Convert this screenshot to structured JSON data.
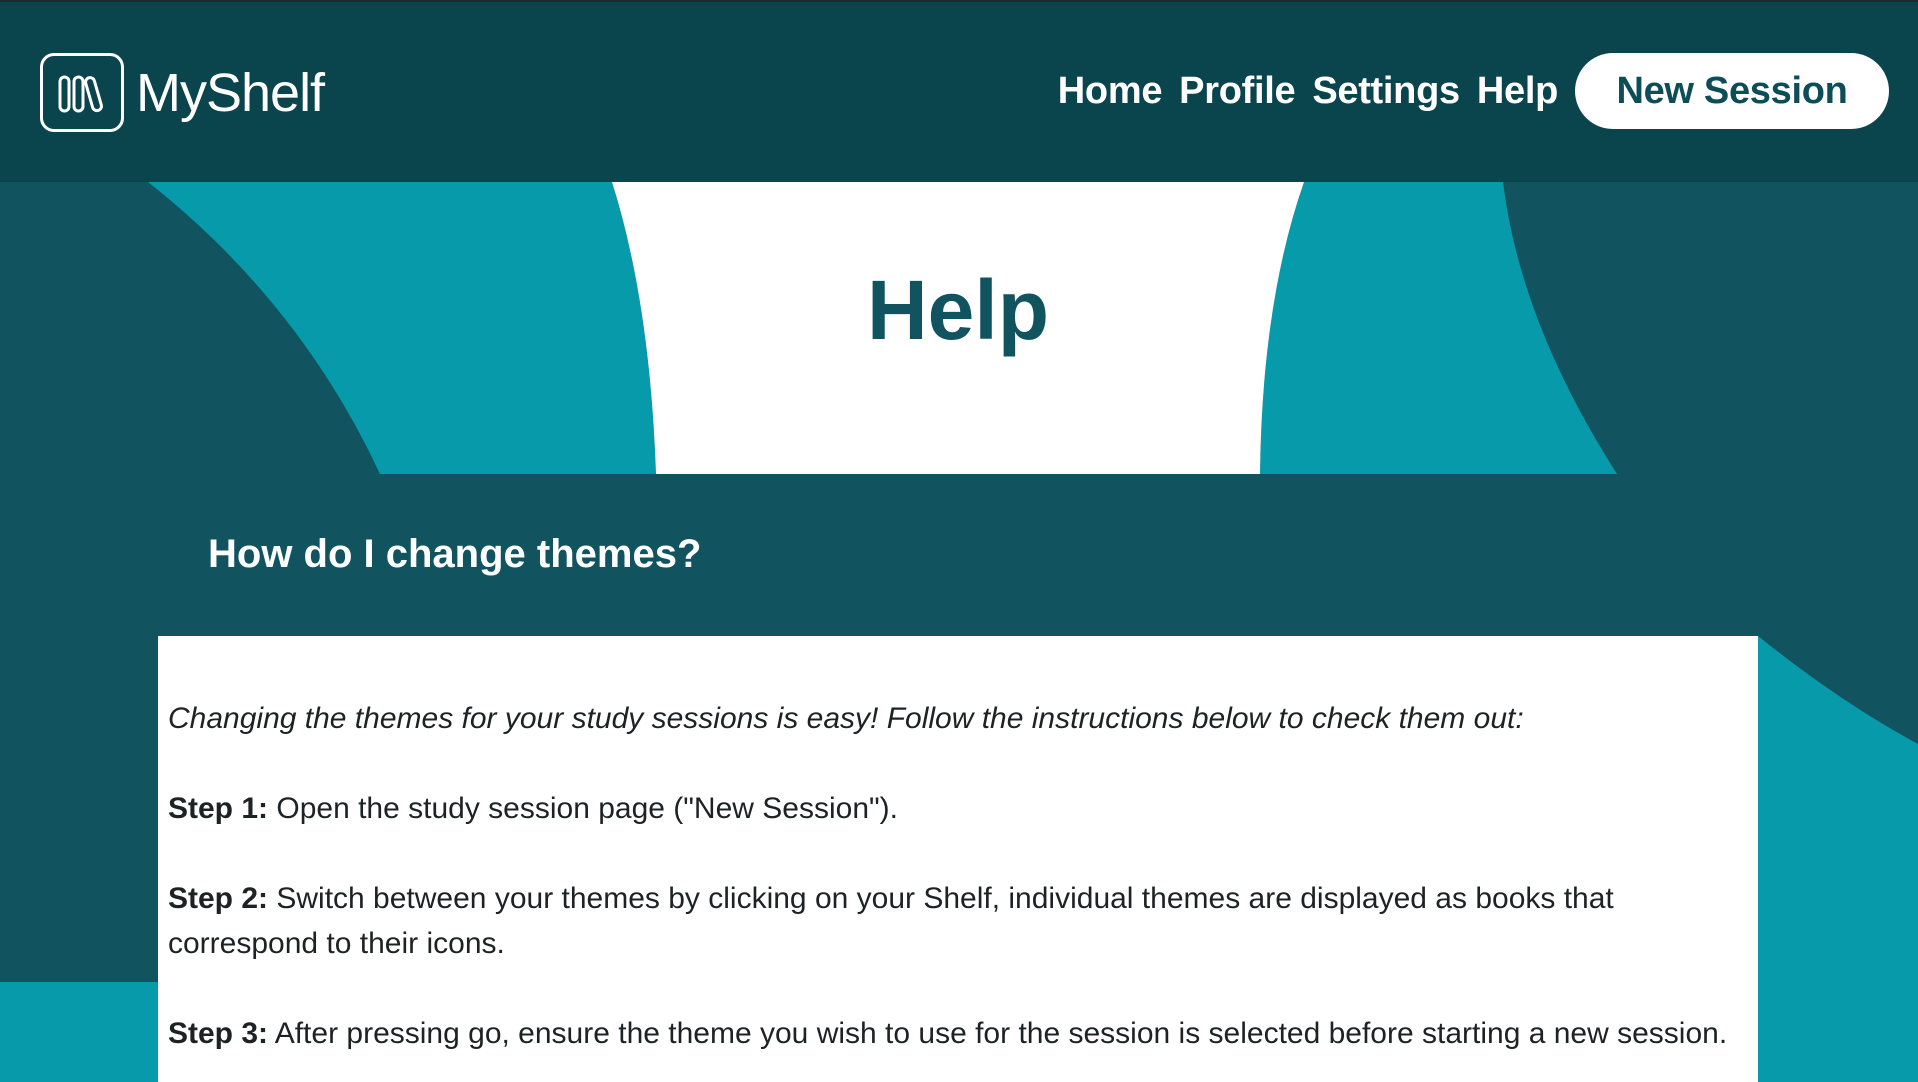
{
  "app": {
    "name": "MyShelf"
  },
  "nav": {
    "links": [
      "Home",
      "Profile",
      "Settings",
      "Help"
    ],
    "cta": "New Session"
  },
  "page": {
    "title": "Help"
  },
  "faq": {
    "question": "How do I change themes?",
    "intro": "Changing the themes for your study sessions is easy! Follow the instructions below to check them out:",
    "steps": [
      {
        "label": "Step 1:",
        "text": " Open the study session page (\"New Session\")."
      },
      {
        "label": "Step 2:",
        "text": " Switch between your themes by clicking on your Shelf, individual themes are displayed as books that correspond to their icons."
      },
      {
        "label": "Step 3:",
        "text": " After pressing go, ensure the theme you wish to use for the session is selected before starting a new session."
      }
    ]
  },
  "colors": {
    "nav_bg": "#0a454e",
    "dark_teal": "#11545f",
    "bright_teal": "#069aab",
    "white": "#ffffff"
  }
}
